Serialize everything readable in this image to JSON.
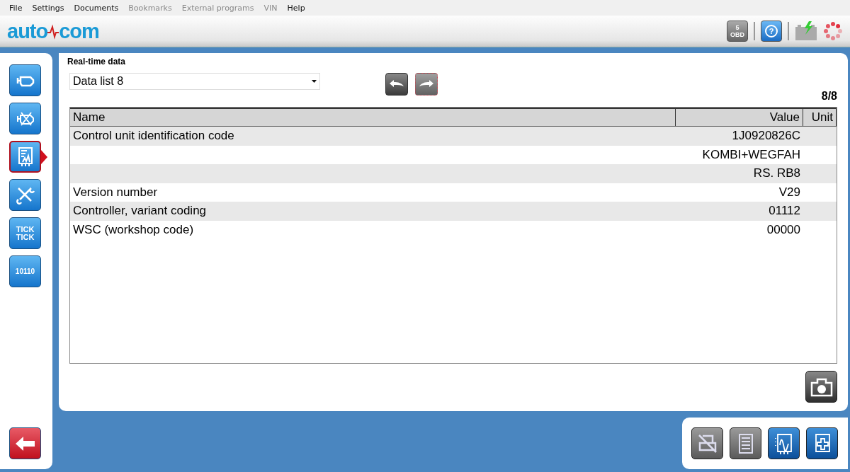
{
  "menu": [
    {
      "label": "File",
      "disabled": false
    },
    {
      "label": "Settings",
      "disabled": false
    },
    {
      "label": "Documents",
      "disabled": false
    },
    {
      "label": "Bookmarks",
      "disabled": true
    },
    {
      "label": "External programs",
      "disabled": true
    },
    {
      "label": "VIN",
      "disabled": true
    },
    {
      "label": "Help",
      "disabled": false
    }
  ],
  "logo": {
    "left": "auto",
    "right": "com"
  },
  "status_icons": [
    {
      "kind": "obd",
      "label": "5",
      "sublabel": "OBD",
      "disabled": true
    },
    {
      "kind": "help",
      "label": "?",
      "disabled": false
    },
    {
      "kind": "battery",
      "disabled": true
    },
    {
      "kind": "spinner",
      "disabled": false
    }
  ],
  "sidebar": {
    "items": [
      {
        "kind": "engine",
        "selected": false
      },
      {
        "kind": "engine-clear",
        "selected": false
      },
      {
        "kind": "monitor",
        "selected": true
      },
      {
        "kind": "tools",
        "selected": false
      },
      {
        "kind": "text",
        "text": "TICK TICK",
        "selected": false
      },
      {
        "kind": "binary",
        "text": "10110",
        "selected": false
      }
    ]
  },
  "tab": {
    "label": "Real-time data"
  },
  "data_list": {
    "value": "Data list 8"
  },
  "nav": [
    {
      "kind": "back",
      "focused": false
    },
    {
      "kind": "forward",
      "focused": true
    }
  ],
  "page_counter": "8/8",
  "table": {
    "columns": [
      "Name",
      "Value",
      "Unit"
    ],
    "rows": [
      {
        "name": "Control unit identification code",
        "value": "1J0920826C"
      },
      {
        "value": "KOMBI+WEGFAH"
      },
      {
        "value": "RS. RB8"
      },
      {
        "name": "Version number",
        "value": "V29"
      },
      {
        "name": "Controller, variant coding",
        "value": "01112"
      },
      {
        "name": "WSC (workshop code)",
        "value": "00000"
      }
    ]
  },
  "toolbar": [
    {
      "kind": "print",
      "disabled": true
    },
    {
      "kind": "list",
      "disabled": true
    },
    {
      "kind": "graph",
      "disabled": false
    },
    {
      "kind": "medic",
      "disabled": false
    }
  ]
}
